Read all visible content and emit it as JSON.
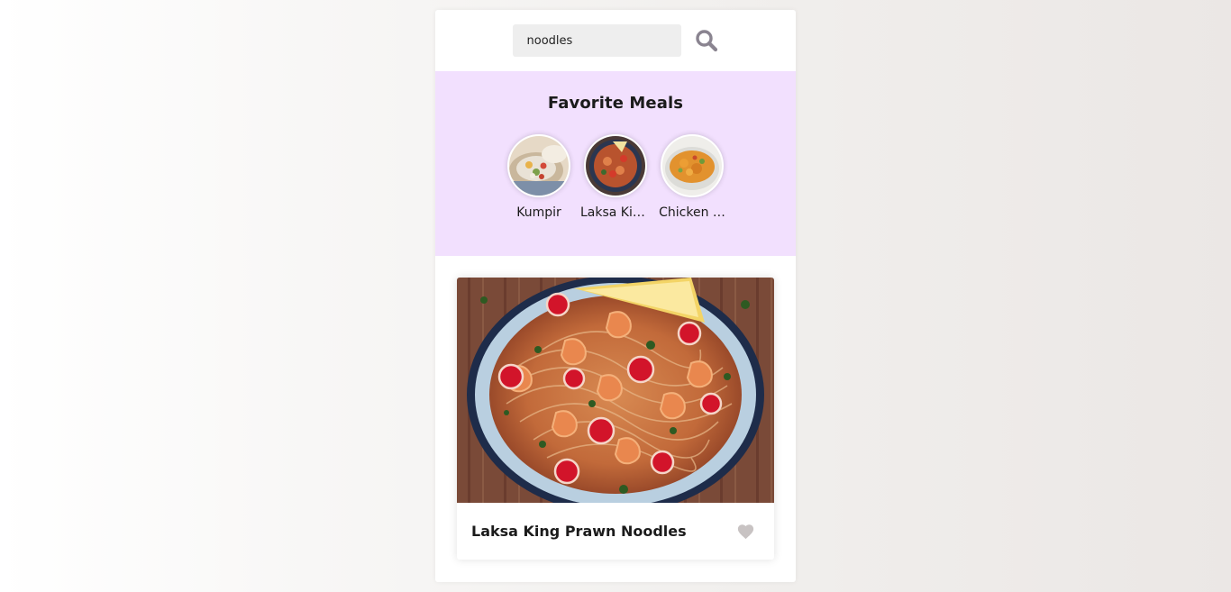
{
  "search": {
    "value": "noodles",
    "button_icon": "search-icon",
    "icon_color": "#8a8490"
  },
  "favorites": {
    "title": "Favorite Meals",
    "background": "#f2e0fe",
    "items": [
      {
        "name": "Kumpir",
        "icon": "kumpir-photo"
      },
      {
        "name": "Laksa Kin…",
        "icon": "laksa-photo"
      },
      {
        "name": "Chicken …",
        "icon": "chicken-photo"
      }
    ]
  },
  "meal": {
    "name": "Laksa King Prawn Noodles",
    "image": "laksa-noodles-photo",
    "favorite_icon": "heart-icon",
    "favorite_color": "#c8c3c3"
  }
}
